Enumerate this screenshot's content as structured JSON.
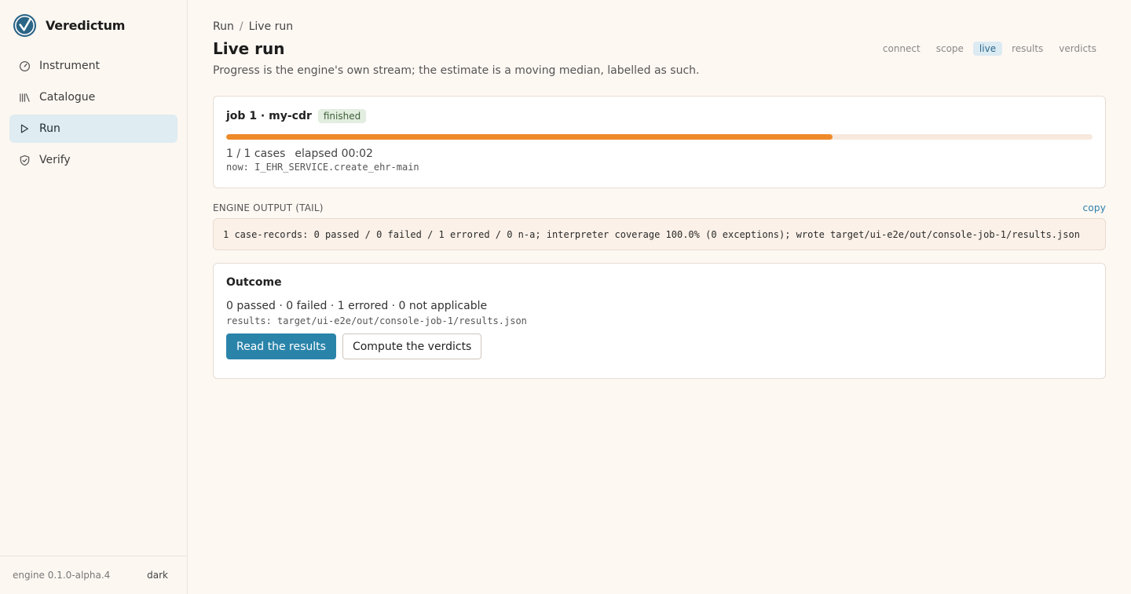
{
  "app": {
    "name": "Veredictum"
  },
  "sidebar": {
    "items": [
      {
        "label": "Instrument",
        "icon": "gauge-icon"
      },
      {
        "label": "Catalogue",
        "icon": "library-icon"
      },
      {
        "label": "Run",
        "icon": "play-icon",
        "active": true
      },
      {
        "label": "Verify",
        "icon": "shield-check-icon"
      }
    ],
    "footer": {
      "version": "engine 0.1.0-alpha.4",
      "theme_toggle": "dark"
    }
  },
  "breadcrumb": {
    "parent": "Run",
    "separator": "/",
    "current": "Live run"
  },
  "page": {
    "title": "Live run",
    "subtitle": "Progress is the engine's own stream; the estimate is a moving median, labelled as such."
  },
  "steps": [
    {
      "label": "connect"
    },
    {
      "label": "scope"
    },
    {
      "label": "live",
      "active": true
    },
    {
      "label": "results"
    },
    {
      "label": "verdicts"
    }
  ],
  "job": {
    "title": "job 1 · my-cdr",
    "status": "finished",
    "progress_fraction": 0.7,
    "cases": "1 / 1 cases",
    "elapsed": "elapsed 00:02",
    "now": "now: I_EHR_SERVICE.create_ehr-main"
  },
  "output": {
    "heading": "ENGINE OUTPUT (TAIL)",
    "copy_label": "copy",
    "text": "1 case-records: 0 passed / 0 failed / 1 errored / 0 n-a; interpreter coverage 100.0% (0 exceptions); wrote target/ui-e2e/out/console-job-1/results.json"
  },
  "outcome": {
    "title": "Outcome",
    "summary": "0 passed · 0 failed · 1 errored · 0 not applicable",
    "results_path": "results: target/ui-e2e/out/console-job-1/results.json",
    "primary_button": "Read the results",
    "secondary_button": "Compute the verdicts"
  },
  "colors": {
    "accent": "#2a84aa",
    "progress": "#ef8a2a",
    "active_nav": "#dfecf1",
    "badge_bg": "#e2eedf"
  }
}
